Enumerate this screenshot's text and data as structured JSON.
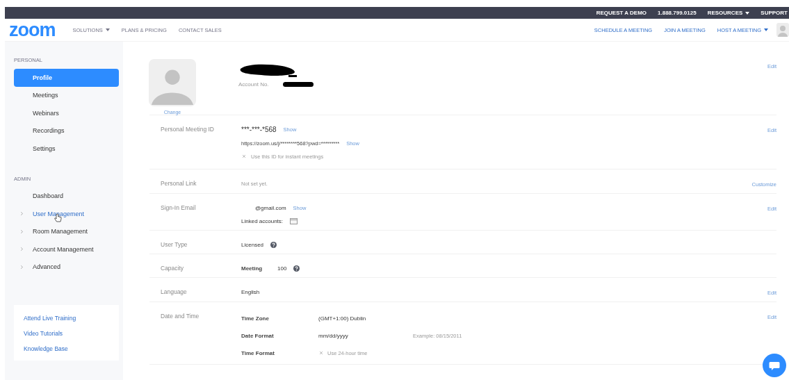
{
  "top_bar": {
    "links": [
      {
        "label": "REQUEST A DEMO",
        "dropdown": false
      },
      {
        "label": "1.888.799.0125",
        "dropdown": false
      },
      {
        "label": "RESOURCES",
        "dropdown": true
      },
      {
        "label": "SUPPORT",
        "dropdown": false
      }
    ]
  },
  "nav": {
    "logo": "zoom",
    "menu": [
      {
        "label": "SOLUTIONS",
        "dropdown": true
      },
      {
        "label": "PLANS & PRICING",
        "dropdown": false
      },
      {
        "label": "CONTACT SALES",
        "dropdown": false
      }
    ],
    "actions": [
      {
        "label": "SCHEDULE A MEETING",
        "dropdown": false
      },
      {
        "label": "JOIN A MEETING",
        "dropdown": false
      },
      {
        "label": "HOST A MEETING",
        "dropdown": true
      }
    ]
  },
  "sidebar": {
    "sections": [
      {
        "heading": "PERSONAL",
        "items": [
          {
            "label": "Profile",
            "selected": true,
            "expandable": false,
            "hovered": false
          },
          {
            "label": "Meetings",
            "selected": false,
            "expandable": false,
            "hovered": false
          },
          {
            "label": "Webinars",
            "selected": false,
            "expandable": false,
            "hovered": false
          },
          {
            "label": "Recordings",
            "selected": false,
            "expandable": false,
            "hovered": false
          },
          {
            "label": "Settings",
            "selected": false,
            "expandable": false,
            "hovered": false
          }
        ]
      },
      {
        "heading": "ADMIN",
        "items": [
          {
            "label": "Dashboard",
            "selected": false,
            "expandable": false,
            "hovered": false
          },
          {
            "label": "User Management",
            "selected": false,
            "expandable": true,
            "hovered": true
          },
          {
            "label": "Room Management",
            "selected": false,
            "expandable": true,
            "hovered": false
          },
          {
            "label": "Account Management",
            "selected": false,
            "expandable": true,
            "hovered": false
          },
          {
            "label": "Advanced",
            "selected": false,
            "expandable": true,
            "hovered": false
          }
        ]
      }
    ],
    "help_links": [
      "Attend Live Training",
      "Video Tutorials",
      "Knowledge Base"
    ]
  },
  "profile": {
    "change": "Change",
    "account_label": "Account No.",
    "action": "Edit"
  },
  "rows": [
    {
      "kind": "meeting_id",
      "label": "Personal Meeting ID",
      "id": "***-***-*568",
      "id_show": "Show",
      "url": "https://zoom.us/j/********568?pwd=*********",
      "url_show": "Show",
      "option": {
        "label": "Use this ID for instant meetings",
        "checked": false
      },
      "action": "Edit"
    },
    {
      "kind": "text",
      "label": "Personal Link",
      "value": "Not set yet.",
      "muted": true,
      "help": false,
      "action": "Customize"
    },
    {
      "kind": "email",
      "label": "Sign-In Email",
      "value": "@gmail.com",
      "show": "Show",
      "linked": "Linked accounts:",
      "action": "Edit"
    },
    {
      "kind": "text",
      "label": "User Type",
      "value": "Licensed",
      "muted": false,
      "help": true
    },
    {
      "kind": "capacity",
      "label": "Capacity",
      "name": "Meeting",
      "value": "100",
      "help": true
    },
    {
      "kind": "text",
      "label": "Language",
      "value": "English",
      "muted": false,
      "help": false,
      "action": "Edit"
    },
    {
      "kind": "settings",
      "label": "Date and Time",
      "action": "Edit",
      "items": [
        {
          "kind": "value",
          "label": "Time Zone",
          "value": "(GMT+1:00) Dublin"
        },
        {
          "kind": "value",
          "label": "Date Format",
          "value": "mm/dd/yyyy",
          "note": "Example: 08/15/2011"
        },
        {
          "kind": "checkbox",
          "label": "Time Format",
          "value": "Use 24-hour time",
          "checked": false
        }
      ]
    }
  ]
}
